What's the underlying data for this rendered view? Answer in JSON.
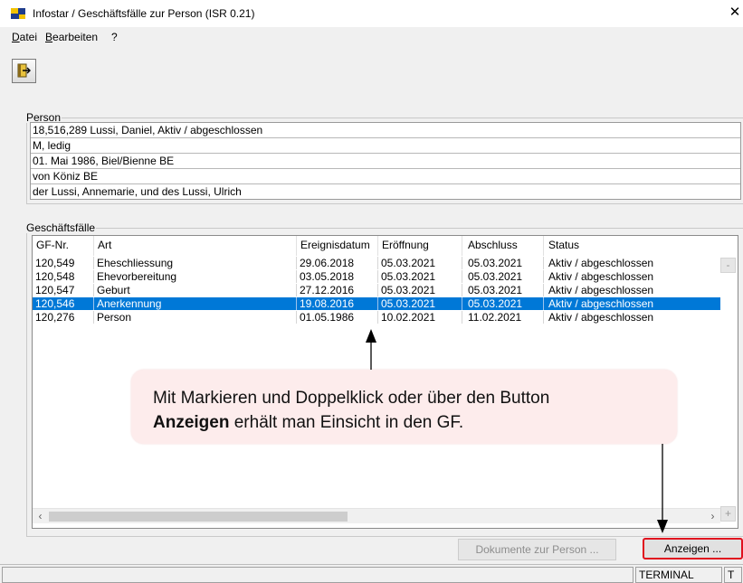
{
  "window": {
    "title": "Infostar / Geschäftsfälle zur Person (ISR 0.21)",
    "close_glyph": "✕"
  },
  "menu": {
    "datei_first": "D",
    "datei_rest": "atei",
    "bearbeiten_first": "B",
    "bearbeiten_rest": "earbeiten",
    "help": "?"
  },
  "toolbar": {
    "exit_icon": "exit-door-icon"
  },
  "person": {
    "label": "Person",
    "rows": [
      "18,516,289  Lussi, Daniel, Aktiv / abgeschlossen",
      "M, ledig",
      "01. Mai 1986, Biel/Bienne BE",
      "von Köniz BE",
      "der Lussi, Annemarie, und des Lussi, Ulrich"
    ]
  },
  "cases": {
    "label": "Geschäftsfälle",
    "columns": [
      "GF-Nr.",
      "Art",
      "Ereignisdatum",
      "Eröffnung",
      "Abschluss",
      "Status"
    ],
    "rows": [
      [
        "120,549",
        "Eheschliessung",
        "29.06.2018",
        "05.03.2021",
        "05.03.2021",
        "Aktiv / abgeschlossen"
      ],
      [
        "120,548",
        "Ehevorbereitung",
        "03.05.2018",
        "05.03.2021",
        "05.03.2021",
        "Aktiv / abgeschlossen"
      ],
      [
        "120,547",
        "Geburt",
        "27.12.2016",
        "05.03.2021",
        "05.03.2021",
        "Aktiv / abgeschlossen"
      ],
      [
        "120,546",
        "Anerkennung",
        "19.08.2016",
        "05.03.2021",
        "05.03.2021",
        "Aktiv / abgeschlossen"
      ],
      [
        "120,276",
        "Person",
        "01.05.1986",
        "10.02.2021",
        "11.02.2021",
        "Aktiv / abgeschlossen"
      ]
    ],
    "selected_index": 3,
    "scroll_left": "‹",
    "scroll_right": "›",
    "side_minus": "-",
    "side_plus": "+"
  },
  "buttons": {
    "documents": "Dokumente zur Person ...",
    "show": "Anzeigen ..."
  },
  "status": {
    "terminal": "TERMINAL",
    "right": "T"
  },
  "annotation": {
    "line1": "Mit Markieren und Doppelklick oder über den Button",
    "line2_bold": "Anzeigen",
    "line2_rest": " erhält man Einsicht in den GF."
  },
  "colors": {
    "selection": "#0078d7",
    "highlight_border": "#e0101e",
    "callout_bg": "#fdecec"
  }
}
